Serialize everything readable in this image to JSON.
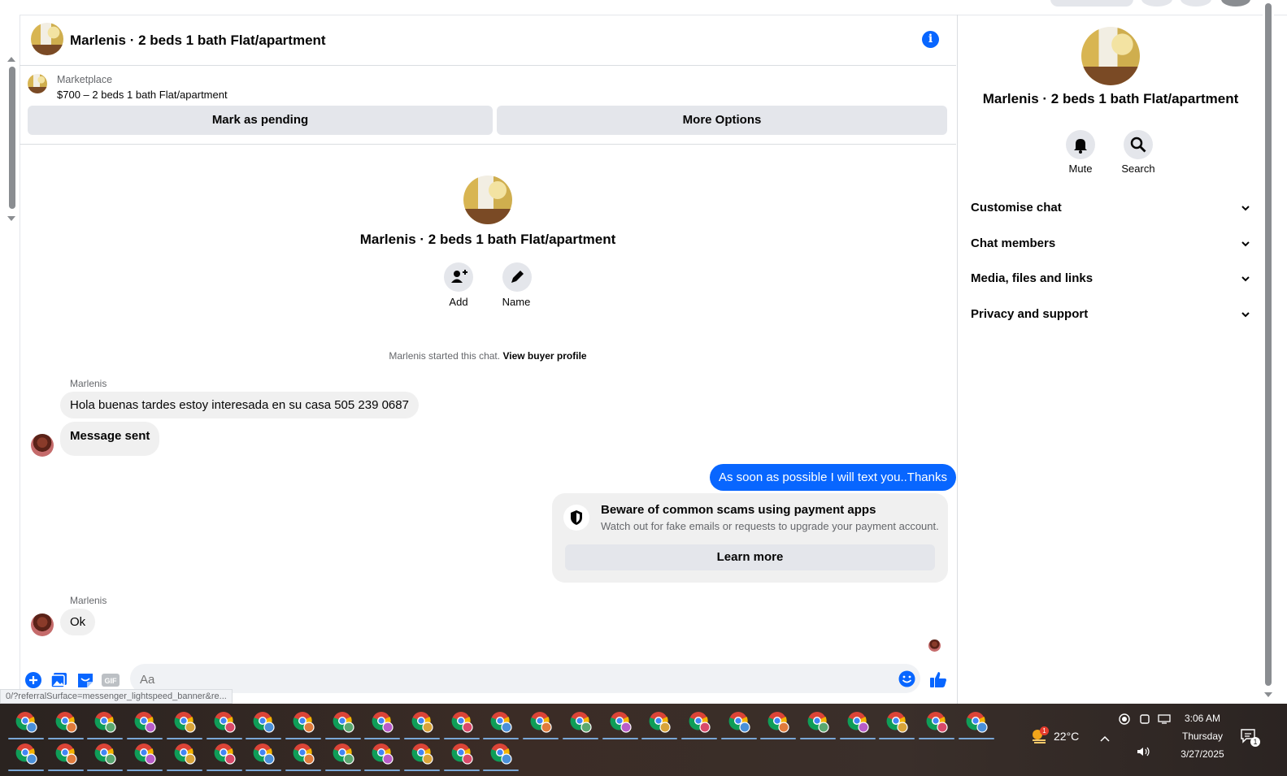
{
  "chat": {
    "title": "Marlenis · 2 beds 1 bath Flat/apartment"
  },
  "marketplace": {
    "label": "Marketplace",
    "listing": "$700 – 2 beds 1 bath Flat/apartment",
    "mark_pending": "Mark as pending",
    "more_options": "More Options"
  },
  "intro": {
    "title": "Marlenis · 2 beds 1 bath Flat/apartment",
    "add_label": "Add",
    "name_label": "Name",
    "started_text": "Marlenis started this chat.",
    "view_profile": "View buyer profile"
  },
  "messages": {
    "sender1": "Marlenis",
    "msg1": "Hola buenas tardes estoy interesada en su casa 505 239 0687",
    "msg2": "Message sent",
    "out1": "As soon as possible I will text you..Thanks",
    "sender2": "Marlenis",
    "msg3": "Ok"
  },
  "scam_notice": {
    "title": "Beware of common scams using payment apps",
    "body": "Watch out for fake emails or requests to upgrade your payment account.",
    "learn_more": "Learn more"
  },
  "composer": {
    "placeholder": "Aa"
  },
  "status_url": "0/?referralSurface=messenger_lightspeed_banner&re...",
  "right_panel": {
    "title": "Marlenis · 2 beds 1 bath Flat/apartment",
    "mute_label": "Mute",
    "search_label": "Search",
    "sections": [
      "Customise chat",
      "Chat members",
      "Media, files and links",
      "Privacy and support"
    ]
  },
  "taskbar": {
    "weather_temp": "22°C",
    "weather_badge": "1",
    "time": "3:06 AM",
    "day": "Thursday",
    "date": "3/27/2025",
    "notif_count": "1",
    "pinned_row1_count": 25,
    "pinned_row2_count": 13
  },
  "colors": {
    "accent": "#0866ff",
    "bubble_in": "#f0f0f0",
    "button_gray": "#e4e6eb"
  }
}
